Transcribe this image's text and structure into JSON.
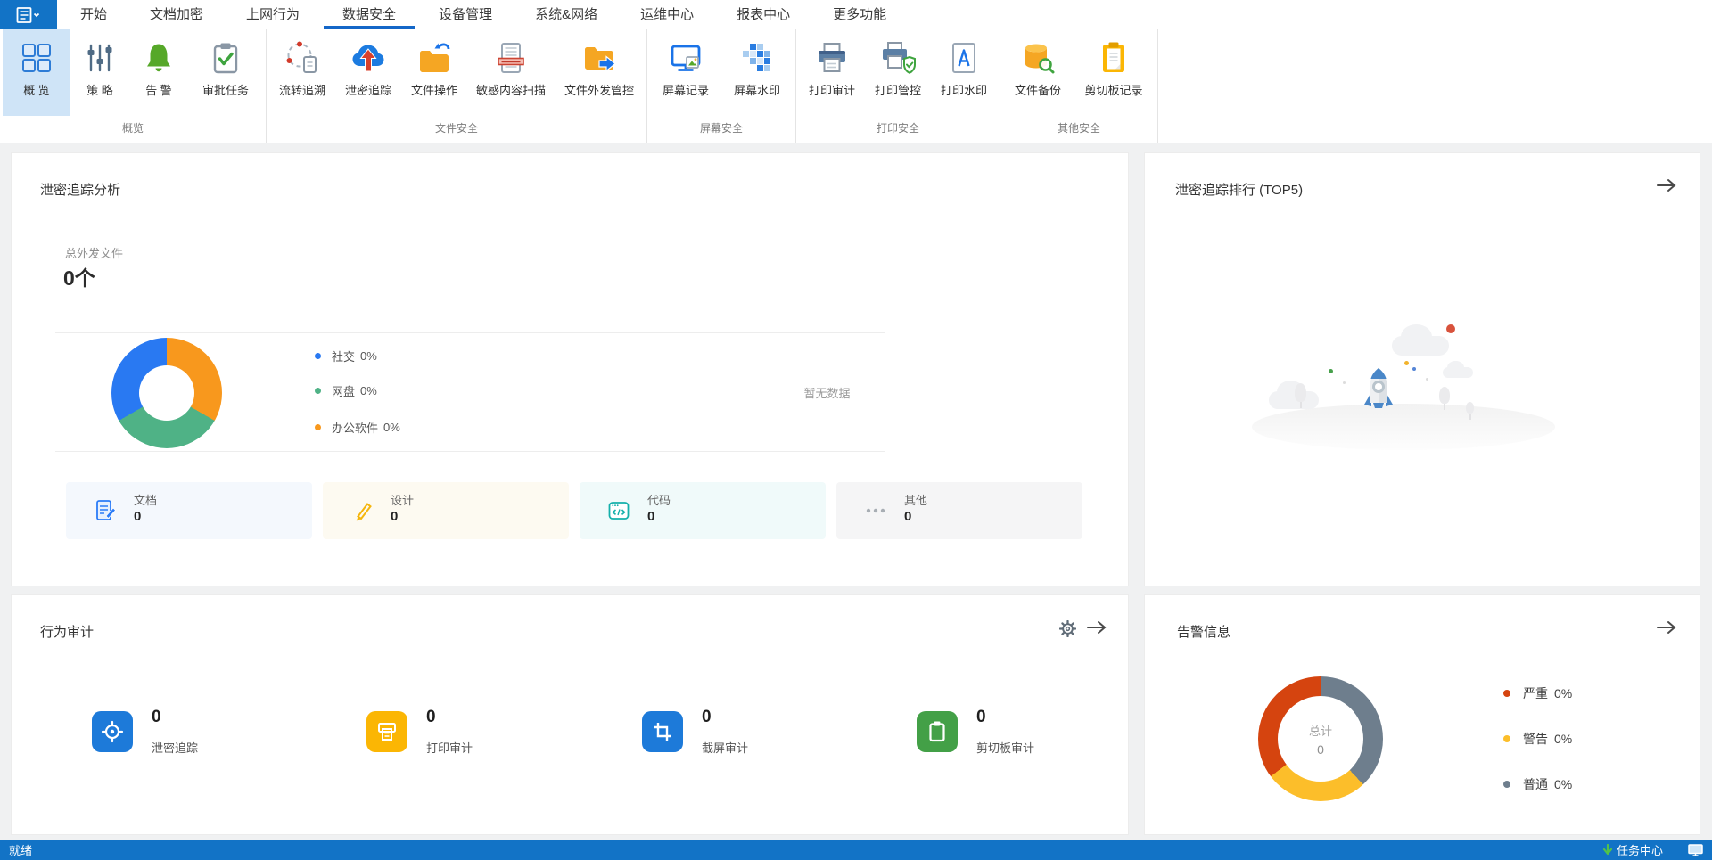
{
  "colors": {
    "accent_blue": "#1273c6",
    "tab_underline": "#1467c8",
    "selected_ribbon_bg": "#cfe4f7",
    "content_bg": "#f0f1f2",
    "trace_donut": {
      "社交": "#2979f2",
      "网盘": "#4fb286",
      "办公软件": "#f8981d"
    },
    "alerts_donut": {
      "严重": "#d5440f",
      "警告": "#fcbe2a",
      "普通": "#6e7e8d"
    },
    "behavior_icons": [
      "#1d7ad9",
      "#fbb604",
      "#1d7ad9",
      "#43a047"
    ]
  },
  "menu_bar": {
    "app_button": {
      "icon": "app-menu-icon"
    },
    "tabs": [
      {
        "label": "开始"
      },
      {
        "label": "文档加密"
      },
      {
        "label": "上网行为"
      },
      {
        "label": "数据安全",
        "active": true
      },
      {
        "label": "设备管理"
      },
      {
        "label": "系统&网络"
      },
      {
        "label": "运维中心"
      },
      {
        "label": "报表中心"
      },
      {
        "label": "更多功能"
      }
    ]
  },
  "ribbon": {
    "groups": [
      {
        "label": "概览",
        "buttons": [
          {
            "label": "概 览",
            "icon": "overview-grid-icon",
            "selected": true
          },
          {
            "label": "策 略",
            "icon": "policy-sliders-icon"
          },
          {
            "label": "告 警",
            "icon": "alert-bell-icon"
          },
          {
            "label": "审批任务",
            "icon": "approval-clipboard-icon"
          }
        ]
      },
      {
        "label": "文件安全",
        "buttons": [
          {
            "label": "流转追溯",
            "icon": "flow-trace-icon"
          },
          {
            "label": "泄密追踪",
            "icon": "leak-trace-cloud-icon"
          },
          {
            "label": "文件操作",
            "icon": "file-operation-folder-icon"
          },
          {
            "label": "敏感内容扫描",
            "icon": "sensitive-scan-icon"
          },
          {
            "label": "文件外发管控",
            "icon": "file-outgoing-icon"
          }
        ]
      },
      {
        "label": "屏幕安全",
        "buttons": [
          {
            "label": "屏幕记录",
            "icon": "screen-record-icon"
          },
          {
            "label": "屏幕水印",
            "icon": "screen-watermark-icon"
          }
        ]
      },
      {
        "label": "打印安全",
        "buttons": [
          {
            "label": "打印审计",
            "icon": "print-audit-icon"
          },
          {
            "label": "打印管控",
            "icon": "print-control-icon"
          },
          {
            "label": "打印水印",
            "icon": "print-watermark-icon"
          }
        ]
      },
      {
        "label": "其他安全",
        "buttons": [
          {
            "label": "文件备份",
            "icon": "file-backup-icon"
          },
          {
            "label": "剪切板记录",
            "icon": "clipboard-record-icon"
          }
        ]
      }
    ]
  },
  "trace_analysis": {
    "title": "泄密追踪分析",
    "total_label": "总外发文件",
    "total_value": "0个",
    "legend": [
      {
        "label": "社交",
        "value": "0%"
      },
      {
        "label": "网盘",
        "value": "0%"
      },
      {
        "label": "办公软件",
        "value": "0%"
      }
    ],
    "no_data": "暂无数据",
    "cards": [
      {
        "label": "文档",
        "value": "0",
        "icon": "document-pen-icon"
      },
      {
        "label": "设计",
        "value": "0",
        "icon": "pencil-icon"
      },
      {
        "label": "代码",
        "value": "0",
        "icon": "code-icon"
      },
      {
        "label": "其他",
        "value": "0",
        "icon": "ellipsis-icon"
      }
    ]
  },
  "trace_ranking": {
    "title": "泄密追踪排行 (TOP5)"
  },
  "behavior_audit": {
    "title": "行为审计",
    "items": [
      {
        "label": "泄密追踪",
        "value": "0",
        "icon": "target-icon"
      },
      {
        "label": "打印审计",
        "value": "0",
        "icon": "printer-receipt-icon"
      },
      {
        "label": "截屏审计",
        "value": "0",
        "icon": "crop-icon"
      },
      {
        "label": "剪切板审计",
        "value": "0",
        "icon": "clipboard-icon"
      }
    ]
  },
  "alerts": {
    "title": "告警信息",
    "center_label": "总计",
    "center_value": "0",
    "legend": [
      {
        "label": "严重",
        "value": "0%"
      },
      {
        "label": "警告",
        "value": "0%"
      },
      {
        "label": "普通",
        "value": "0%"
      }
    ]
  },
  "status_bar": {
    "ready": "就绪",
    "task_center": "任务中心"
  },
  "chart_data": [
    {
      "type": "pie",
      "variant": "donut",
      "panel": "泄密追踪分析",
      "categories": [
        "社交",
        "网盘",
        "办公软件"
      ],
      "values": [
        0,
        0,
        0
      ],
      "labels_shown": [
        "社交 0%",
        "网盘 0%",
        "办公软件 0%"
      ],
      "colors": [
        "#2979f2",
        "#4fb286",
        "#f8981d"
      ],
      "segments_degrees_clockwise_from_top": {
        "办公软件": [
          0,
          120
        ],
        "网盘": [
          120,
          240
        ],
        "社交": [
          240,
          360
        ]
      },
      "legend_position": "right"
    },
    {
      "type": "pie",
      "variant": "donut",
      "panel": "告警信息",
      "categories": [
        "严重",
        "警告",
        "普通"
      ],
      "values": [
        0,
        0,
        0
      ],
      "labels_shown": [
        "严重 0%",
        "警告 0%",
        "普通 0%"
      ],
      "colors": [
        "#d5440f",
        "#fcbe2a",
        "#6e7e8d"
      ],
      "center_label": "总计",
      "center_value": 0,
      "segments_degrees_clockwise_from_top": {
        "普通": [
          0,
          137
        ],
        "警告": [
          137,
          233
        ],
        "严重": [
          233,
          360
        ]
      },
      "legend_position": "right"
    }
  ]
}
